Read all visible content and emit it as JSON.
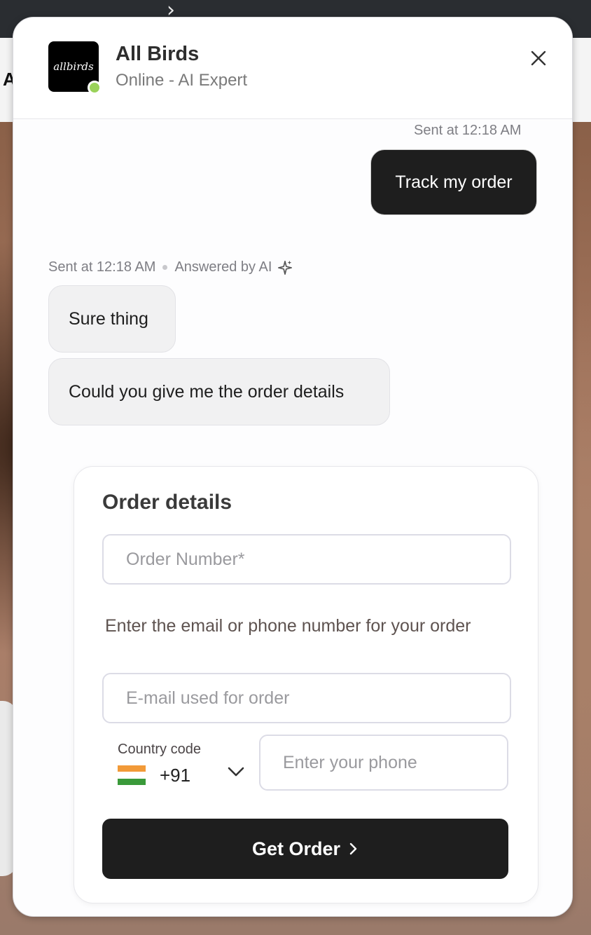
{
  "background": {
    "nav_chevron": "›",
    "nav_letter": "A"
  },
  "widget": {
    "brand": {
      "logo_text": "allbirds",
      "name": "All Birds",
      "status": "Online - AI Expert",
      "online_color": "#9ad25a"
    },
    "close_icon": "close-icon"
  },
  "messages": {
    "user_meta": "Sent at 12:18 AM",
    "user_message": "Track my order",
    "ai_meta_time": "Sent at 12:18 AM",
    "ai_meta_answered": "Answered by AI",
    "ai_messages": [
      "Sure thing",
      "Could you give me the order details"
    ]
  },
  "order_form": {
    "title": "Order details",
    "order_number_placeholder": "Order Number*",
    "hint": "Enter the email or phone number for your order",
    "email_placeholder": "E-mail used for order",
    "country_code_label": "Country code",
    "country_code_value": "+91",
    "phone_placeholder": "Enter your phone",
    "submit_label": "Get Order"
  },
  "colors": {
    "accent_dark": "#1e1e1e",
    "bubble_ai": "#f1f1f2"
  }
}
